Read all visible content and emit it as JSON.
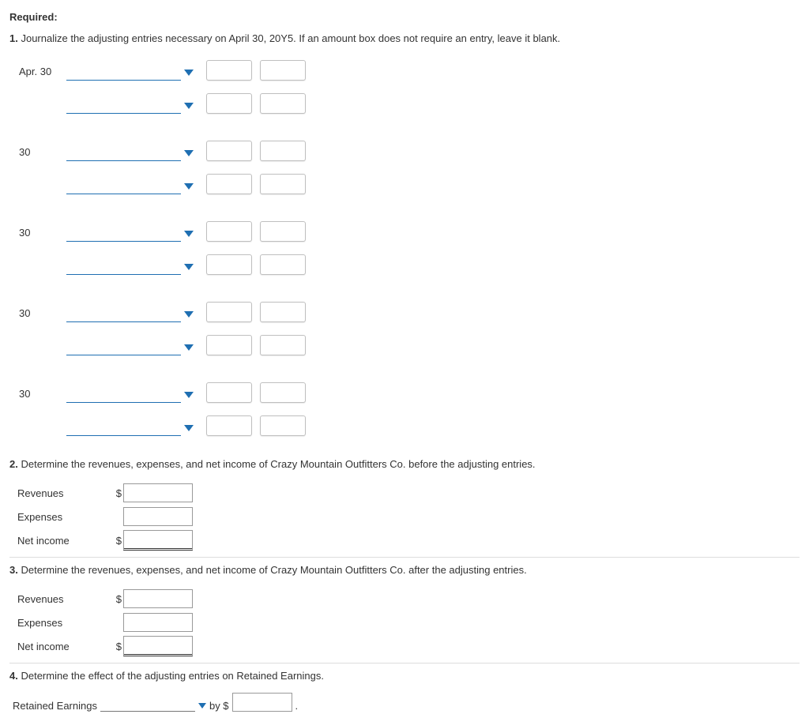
{
  "heading": "Required:",
  "q1": {
    "num": "1.",
    "text": "Journalize the adjusting entries necessary on April 30, 20Y5. If an amount box does not require an entry, leave it blank.",
    "entries": [
      {
        "date": "Apr. 30"
      },
      {
        "date": "30"
      },
      {
        "date": "30"
      },
      {
        "date": "30"
      },
      {
        "date": "30"
      }
    ]
  },
  "q2": {
    "num": "2.",
    "text": "Determine the revenues, expenses, and net income of Crazy Mountain Outfitters Co. before the adjusting entries.",
    "rows": {
      "revenues": "Revenues",
      "expenses": "Expenses",
      "netincome": "Net income"
    },
    "dollar": "$"
  },
  "q3": {
    "num": "3.",
    "text": "Determine the revenues, expenses, and net income of Crazy Mountain Outfitters Co. after the adjusting entries.",
    "rows": {
      "revenues": "Revenues",
      "expenses": "Expenses",
      "netincome": "Net income"
    },
    "dollar": "$"
  },
  "q4": {
    "num": "4.",
    "text": "Determine the effect of the adjusting entries on Retained Earnings.",
    "label": "Retained Earnings",
    "by": "by $",
    "period": "."
  }
}
